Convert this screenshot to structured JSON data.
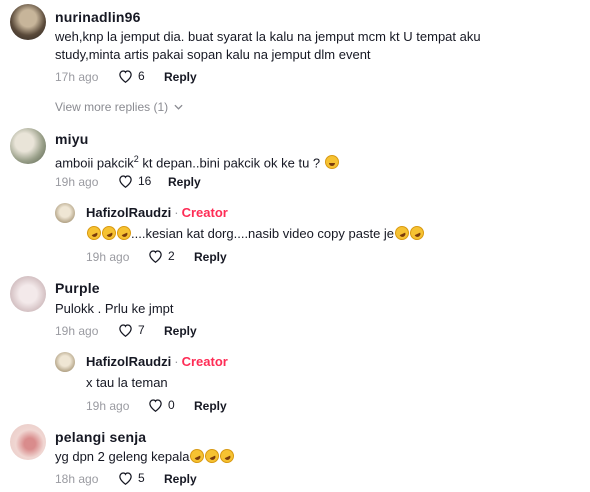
{
  "comments": [
    {
      "username": "nurinadlin96",
      "text_lines": [
        "weh,knp la jemput dia. buat syarat la kalu na jemput mcm kt U tempat aku",
        "study,minta artis pakai sopan kalu na jemput dlm event"
      ],
      "time": "17h ago",
      "likes": "6",
      "reply_label": "Reply",
      "view_more": "View more replies (1)"
    },
    {
      "username": "miyu",
      "text_pre": "amboii pakcik",
      "text_sup": "2",
      "text_post": " kt depan..bini pakcik ok ke tu ?",
      "emojis": [
        "sweat-smile-emoji"
      ],
      "time": "19h ago",
      "likes": "16",
      "reply_label": "Reply",
      "reply": {
        "username": "HafizolRaudzi",
        "separator": "·",
        "badge": "Creator",
        "text": "....kesian kat dorg....nasib video copy paste je",
        "time": "19h ago",
        "likes": "2",
        "reply_label": "Reply"
      }
    },
    {
      "username": "Purple",
      "text": "Pulokk . Prlu ke jmpt",
      "time": "19h ago",
      "likes": "7",
      "reply_label": "Reply",
      "reply": {
        "username": "HafizolRaudzi",
        "separator": "·",
        "badge": "Creator",
        "text": "x tau la teman",
        "time": "19h ago",
        "likes": "0",
        "reply_label": "Reply"
      }
    },
    {
      "username": "pelangi senja",
      "text": "yg dpn 2 geleng kepala",
      "time": "18h ago",
      "likes": "5",
      "reply_label": "Reply"
    }
  ],
  "colors": {
    "creator": "#fe2c55",
    "meta": "#9a9ba1",
    "text": "#161823"
  }
}
